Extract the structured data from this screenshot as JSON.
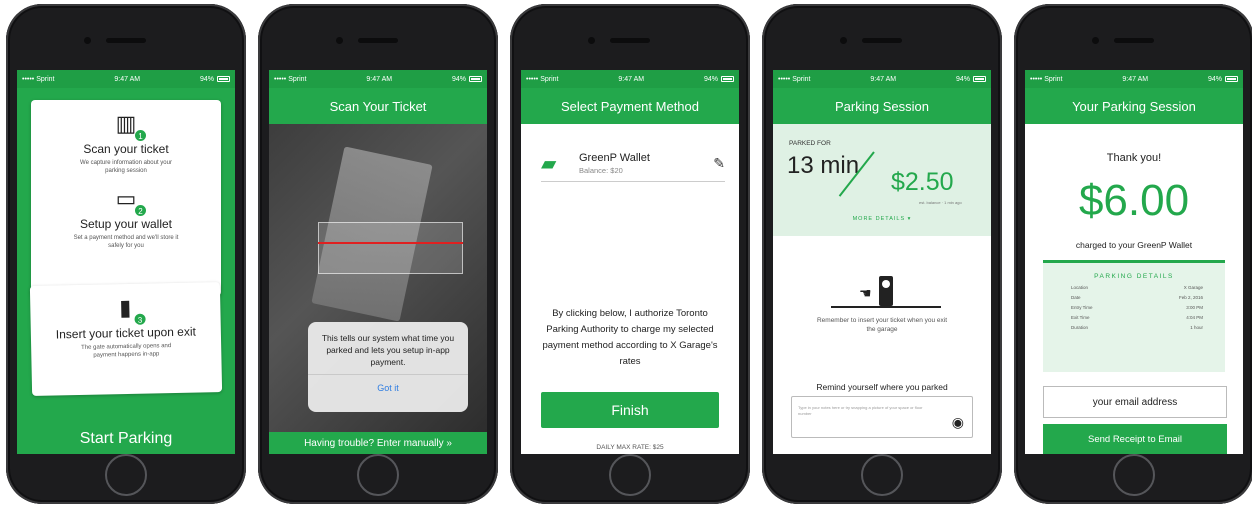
{
  "status": {
    "carrier": "••••• Sprint",
    "time": "9:47 AM",
    "battery": "94%"
  },
  "screen1": {
    "steps": [
      {
        "number": "1",
        "title": "Scan your ticket",
        "desc": "We capture information about your parking session"
      },
      {
        "number": "2",
        "title": "Setup your wallet",
        "desc": "Set a payment method and we'll store it safely for you"
      },
      {
        "number": "3",
        "title": "Insert your ticket upon exit",
        "desc": "The gate automatically opens and payment happens in-app"
      }
    ],
    "start_label": "Start Parking"
  },
  "screen2": {
    "title": "Scan Your Ticket",
    "dialog_text": "This tells our system what time you parked and lets you setup in-app payment.",
    "dialog_button": "Got it",
    "bottom_label": "Having trouble? Enter manually »"
  },
  "screen3": {
    "title": "Select Payment Method",
    "wallet_name": "GreenP Wallet",
    "wallet_balance": "Balance: $20",
    "legal": "By clicking below, I authorize Toronto Parking Authority to charge my selected payment method according to X Garage's rates",
    "finish_label": "Finish",
    "daily_max": "DAILY MAX RATE: $25"
  },
  "screen4": {
    "title": "Parking Session",
    "parked_for": "PARKED FOR",
    "minutes": "13 min",
    "price": "$2.50",
    "price_sub": "est. balance · 1 min ago",
    "more_details": "MORE DETAILS ▾",
    "remember": "Remember to insert your ticket when you exit the garage",
    "remind": "Remind yourself where you parked",
    "note_placeholder": "Type in your notes here or try snapping a picture of your space or floor number"
  },
  "screen5": {
    "title": "Your Parking Session",
    "thanks": "Thank you!",
    "amount": "$6.00",
    "charged": "charged to your GreenP Wallet",
    "details_title": "PARKING DETAILS",
    "details": [
      {
        "label": "Location",
        "value": "X Garage"
      },
      {
        "label": "Date",
        "value": "Feb 2, 2016"
      },
      {
        "label": "Entry Time",
        "value": "3:00 PM"
      },
      {
        "label": "Exit Time",
        "value": "4:04 PM"
      },
      {
        "label": "Duration",
        "value": "1 hour"
      }
    ],
    "email_placeholder": "your email address",
    "send_label": "Send Receipt to Email"
  },
  "colors": {
    "brand": "#23a84c",
    "dark": "#1c1c1e"
  }
}
